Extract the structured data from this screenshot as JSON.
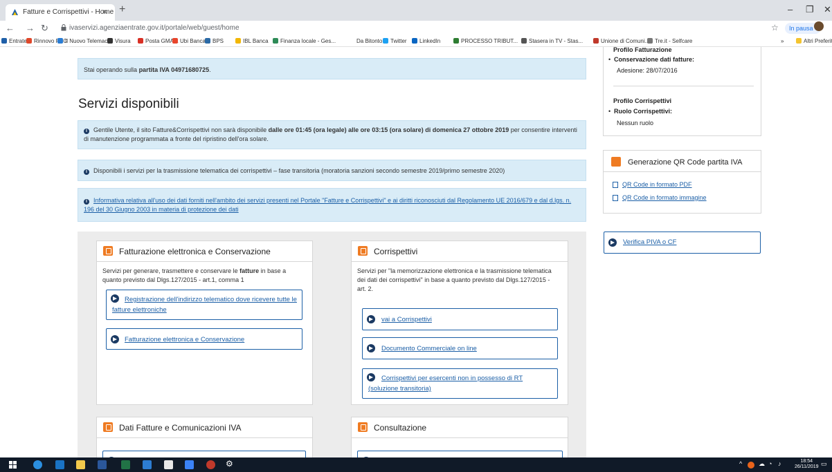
{
  "browser": {
    "tab_title": "Fatture e Corrispettivi - Home",
    "tab_close": "×",
    "new_tab": "+",
    "url": "ivaservizi.agenziaentrate.gov.it/portale/web/guest/home",
    "pause_label": "In pausa",
    "bookmarks": [
      {
        "label": "Entratel",
        "color": "#1f5fa8"
      },
      {
        "label": "Rinnovo PEC",
        "color": "#e0472a"
      },
      {
        "label": "Il Nuovo Telemaco",
        "color": "#2a7dd4"
      },
      {
        "label": "Visura",
        "color": "#333333"
      },
      {
        "label": "Posta GMAIL",
        "color": "#d93025"
      },
      {
        "label": "Ubi Banca",
        "color": "#e8452c"
      },
      {
        "label": "BPS",
        "color": "#2b6aa6"
      },
      {
        "label": "IBL Banca",
        "color": "#f2b705"
      },
      {
        "label": "Finanza locale - Ges...",
        "color": "#2e8b57"
      },
      {
        "label": "Da Bitonto",
        "color": "#ffffff"
      },
      {
        "label": "Twitter",
        "color": "#1da1f2"
      },
      {
        "label": "LinkedIn",
        "color": "#0a66c2"
      },
      {
        "label": "PROCESSO TRIBUT...",
        "color": "#2e7d32"
      },
      {
        "label": "Stasera in TV - Stas...",
        "color": "#555555"
      },
      {
        "label": "Unione di Comuni...",
        "color": "#c0392b"
      },
      {
        "label": "Tre.it - Selfcare",
        "color": "#777777"
      }
    ],
    "more_bookmarks": "»",
    "other_bookmarks": "Altri Preferiti"
  },
  "page": {
    "partita_prefix": "Stai operando sulla ",
    "partita_bold": "partita IVA 04971680725",
    "partita_suffix": ".",
    "title": "Servizi disponibili",
    "notice1_a": "Gentile Utente, il sito Fatture&Corrispettivi non sarà disponibile ",
    "notice1_b": "dalle ore 01:45 (ora legale) alle ore 03:15 (ora solare) di domenica 27 ottobre 2019",
    "notice1_c": " per consentire interventi di manutenzione programmata a fronte del ripristino dell'ora solare.",
    "notice2": "Disponibili i servizi per la trasmissione telematica dei corrispettivi – fase transitoria (moratoria sanzioni secondo semestre 2019/primo semestre 2020)",
    "notice3_link": "Informativa relativa all'uso dei dati forniti nell'ambito dei servizi presenti nel Portale \"Fatture e Corrispettivi\" e ai diritti riconosciuti dal Regolamento UE 2016/679 e dal d.lgs. n. 196 del 30 Giugno 2003 in materia di protezione dei dati",
    "cards": {
      "fatturazione": {
        "title": "Fatturazione elettronica e Conservazione",
        "desc_a": "Servizi per generare, trasmettere e conservare le ",
        "desc_b": "fatture",
        "desc_c": " in base a quanto previsto dal Dlgs.127/2015 - art.1, comma 1",
        "btn1": "Registrazione dell'indirizzo telematico dove ricevere tutte le fatture elettroniche",
        "btn2": "Fatturazione elettronica e Conservazione"
      },
      "corrispettivi": {
        "title": "Corrispettivi",
        "desc": "Servizi per \"la memorizzazione elettronica e la trasmissione telematica dei dati dei corrispettivi\" in base a quanto previsto dal Dlgs.127/2015 - art. 2.",
        "btn1": "vai a Corrispettivi",
        "btn2": "Documento Commerciale on line",
        "btn3": "Corrispettivi per esercenti non in possesso di RT (soluzione transitoria)"
      },
      "dati_fatture": {
        "title": "Dati Fatture e Comunicazioni IVA"
      },
      "consultazione": {
        "title": "Consultazione"
      }
    },
    "sidebar": {
      "profilo_fatturazione": "Profilo Fatturazione",
      "conservazione_label": "Conservazione dati fatture:",
      "adesione": "Adesione: 28/07/2016",
      "profilo_corrispettivi": "Profilo Corrispettivi",
      "ruolo_label": "Ruolo Corrispettivi:",
      "nessun_ruolo": "Nessun ruolo",
      "qr_title": "Generazione QR Code partita IVA",
      "qr_pdf": "QR Code in formato PDF",
      "qr_img": "QR Code in formato immagine",
      "verifica": "Verifica PIVA o CF"
    }
  },
  "taskbar": {
    "time": "18:54",
    "date": "26/11/2019"
  }
}
